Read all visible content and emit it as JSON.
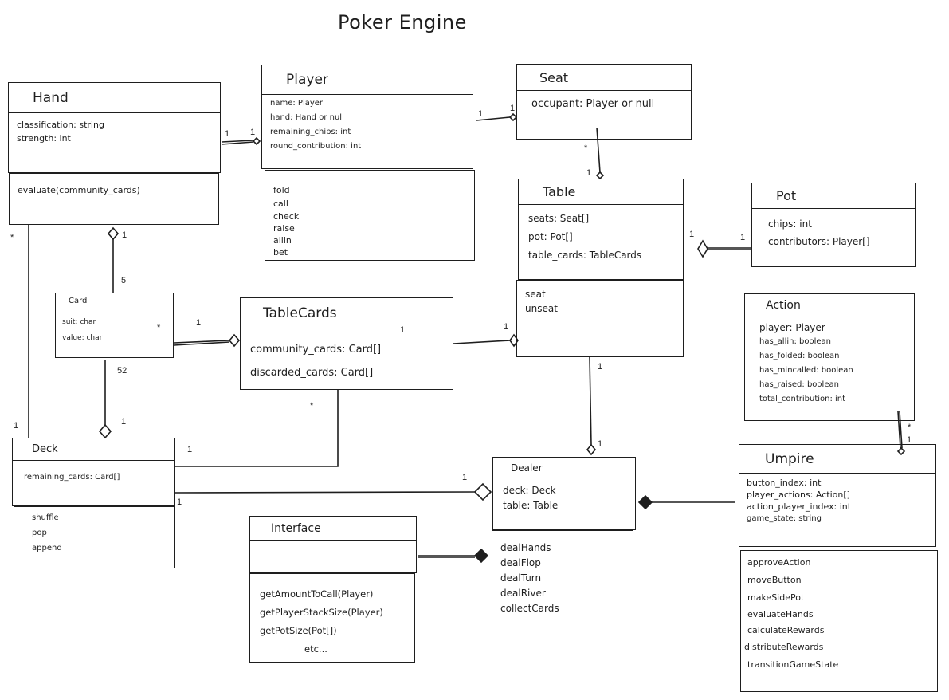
{
  "title": "Poker Engine",
  "classes": {
    "hand": {
      "name": "Hand",
      "attributes": [
        "classification: string",
        "strength: int"
      ],
      "methods": [
        "evaluate(community_cards)"
      ]
    },
    "player": {
      "name": "Player",
      "attributes": [
        "name: Player",
        "hand: Hand or null",
        "remaining_chips: int",
        "round_contribution: int"
      ],
      "methods": [
        "fold",
        "call",
        "check",
        "raise",
        "allin",
        "bet"
      ]
    },
    "seat": {
      "name": "Seat",
      "attributes": [
        "occupant: Player or null"
      ]
    },
    "table": {
      "name": "Table",
      "attributes": [
        "seats: Seat[]",
        "pot: Pot[]",
        "table_cards: TableCards"
      ],
      "methods": [
        "seat",
        "unseat"
      ]
    },
    "pot": {
      "name": "Pot",
      "attributes": [
        "chips: int",
        "contributors: Player[]"
      ]
    },
    "card": {
      "name": "Card",
      "attributes": [
        "suit: char",
        "value: char"
      ]
    },
    "tablecards": {
      "name": "TableCards",
      "attributes": [
        "community_cards: Card[]",
        "discarded_cards: Card[]"
      ]
    },
    "action": {
      "name": "Action",
      "attributes": [
        "player: Player",
        "has_allin: boolean",
        "has_folded: boolean",
        "has_mincalled: boolean",
        "has_raised: boolean",
        "total_contribution: int"
      ]
    },
    "deck": {
      "name": "Deck",
      "attributes": [
        "remaining_cards: Card[]"
      ],
      "methods": [
        "shuffle",
        "pop",
        "append"
      ]
    },
    "dealer": {
      "name": "Dealer",
      "attributes": [
        "deck: Deck",
        "table: Table"
      ],
      "methods": [
        "dealHands",
        "dealFlop",
        "dealTurn",
        "dealRiver",
        "collectCards"
      ]
    },
    "umpire": {
      "name": "Umpire",
      "attributes": [
        "button_index: int",
        "player_actions: Action[]",
        "action_player_index: int",
        "game_state: string"
      ],
      "methods": [
        "approveAction",
        "moveButton",
        "makeSidePot",
        "evaluateHands",
        "calculateRewards",
        "distributeRewards",
        "transitionGameState"
      ]
    },
    "interface": {
      "name": "Interface",
      "attributes": [],
      "methods": [
        "getAmountToCall(Player)",
        "getPlayerStackSize(Player)",
        "getPotSize(Pot[])",
        "etc..."
      ]
    }
  },
  "relationships": [
    {
      "from": "Hand",
      "to": "Player",
      "type": "aggregation",
      "from_mult": "1",
      "to_mult": "1"
    },
    {
      "from": "Player",
      "to": "Seat",
      "type": "aggregation",
      "from_mult": "1",
      "to_mult": "1"
    },
    {
      "from": "Seat",
      "to": "Table",
      "type": "aggregation",
      "from_mult": "*",
      "to_mult": "1"
    },
    {
      "from": "Pot",
      "to": "Table",
      "type": "aggregation",
      "from_mult": "1",
      "to_mult": "1"
    },
    {
      "from": "Card",
      "to": "Hand",
      "type": "aggregation",
      "from_mult": "5",
      "to_mult": "1"
    },
    {
      "from": "Card",
      "to": "TableCards",
      "type": "aggregation",
      "from_mult": "*",
      "to_mult": "1"
    },
    {
      "from": "TableCards",
      "to": "Table",
      "type": "aggregation",
      "from_mult": "1",
      "to_mult": "1"
    },
    {
      "from": "Card",
      "to": "Deck",
      "type": "aggregation",
      "from_mult": "52",
      "to_mult": "1"
    },
    {
      "from": "Hand",
      "to": "Deck",
      "type": "association",
      "from_mult": "*",
      "to_mult": "1"
    },
    {
      "from": "TableCards",
      "to": "Deck",
      "type": "association",
      "from_mult": "*",
      "to_mult": "1"
    },
    {
      "from": "Deck",
      "to": "Dealer",
      "type": "aggregation",
      "from_mult": "1",
      "to_mult": "1"
    },
    {
      "from": "Table",
      "to": "Dealer",
      "type": "aggregation",
      "from_mult": "1",
      "to_mult": "1"
    },
    {
      "from": "Umpire",
      "to": "Dealer",
      "type": "composition",
      "from_mult": "",
      "to_mult": ""
    },
    {
      "from": "Interface",
      "to": "Dealer",
      "type": "composition",
      "from_mult": "",
      "to_mult": ""
    },
    {
      "from": "Action",
      "to": "Umpire",
      "type": "aggregation",
      "from_mult": "*",
      "to_mult": "1"
    }
  ],
  "multiplicity_labels": {
    "hand_player_a": "1",
    "hand_player_b": "1",
    "player_seat_a": "1",
    "player_seat_b": "1",
    "seat_table_a": "*",
    "seat_table_b": "1",
    "pot_table_a": "1",
    "pot_table_b": "1",
    "card_hand_a": "5",
    "card_hand_b": "1",
    "card_tc_a": "*",
    "card_tc_b": "1",
    "tc_table_a": "1",
    "tc_table_b": "1",
    "card_deck_a": "52",
    "card_deck_b": "1",
    "hand_deck_a": "*",
    "hand_deck_b": "1",
    "tc_deck_a": "*",
    "tc_deck_b": "1",
    "deck_dealer_a": "1",
    "deck_dealer_b": "1",
    "table_dealer_a": "1",
    "table_dealer_b": "1",
    "action_umpire_a": "*",
    "action_umpire_b": "1"
  }
}
